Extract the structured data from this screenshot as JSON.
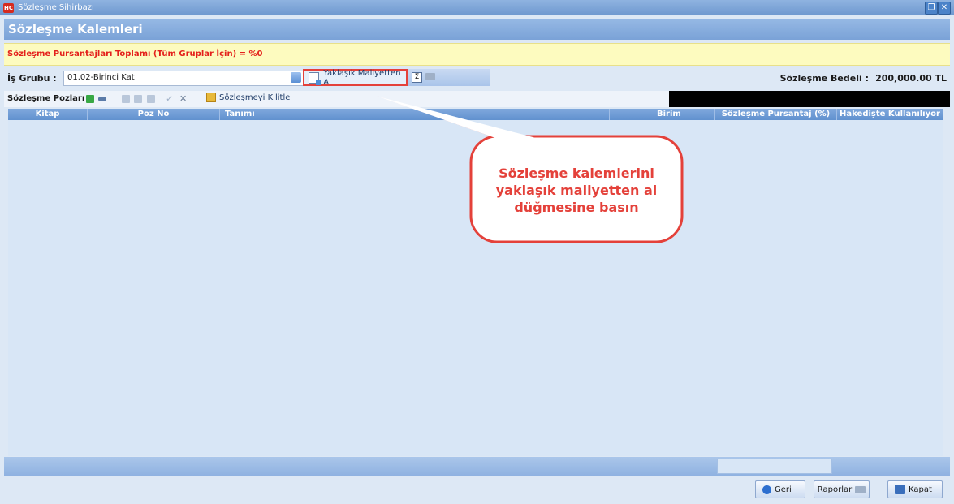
{
  "window": {
    "title": "Sözleşme Sihirbazı",
    "logo_text": "HC",
    "restore_glyph": "❐",
    "close_glyph": "✕"
  },
  "header": {
    "title": "Sözleşme Kalemleri"
  },
  "warning": {
    "text": "Sözleşme Pursantajları Toplamı (Tüm Gruplar İçin) = %0"
  },
  "group": {
    "label": "İş Grubu :",
    "value": "01.02-Birinci Kat",
    "fetch_button": "Yaklaşık Maliyetten Al",
    "sum_glyph": "Σ",
    "contract_label": "Sözleşme Bedeli :",
    "contract_value": "200,000.00 TL"
  },
  "tabstrip": {
    "label": "Sözleşme Pozları",
    "lock_button": "Sözleşmeyi Kilitle"
  },
  "table": {
    "columns": [
      "Kitap",
      "Poz No",
      "Tanımı",
      "Birim",
      "Sözleşme Pursantaj (%)",
      "Hakedişte Kullanılıyor"
    ],
    "rows": []
  },
  "callout": {
    "line1": "Sözleşme kalemlerini",
    "line2": "yaklaşık maliyetten al",
    "line3": "düğmesine basın"
  },
  "buttons": {
    "back_label": "Geri",
    "reports_label": "Raporlar",
    "close_label": "Kapat"
  },
  "colors": {
    "accent": "#6e98cf",
    "warning_text": "#e4201b",
    "highlight": "#e4413a"
  }
}
